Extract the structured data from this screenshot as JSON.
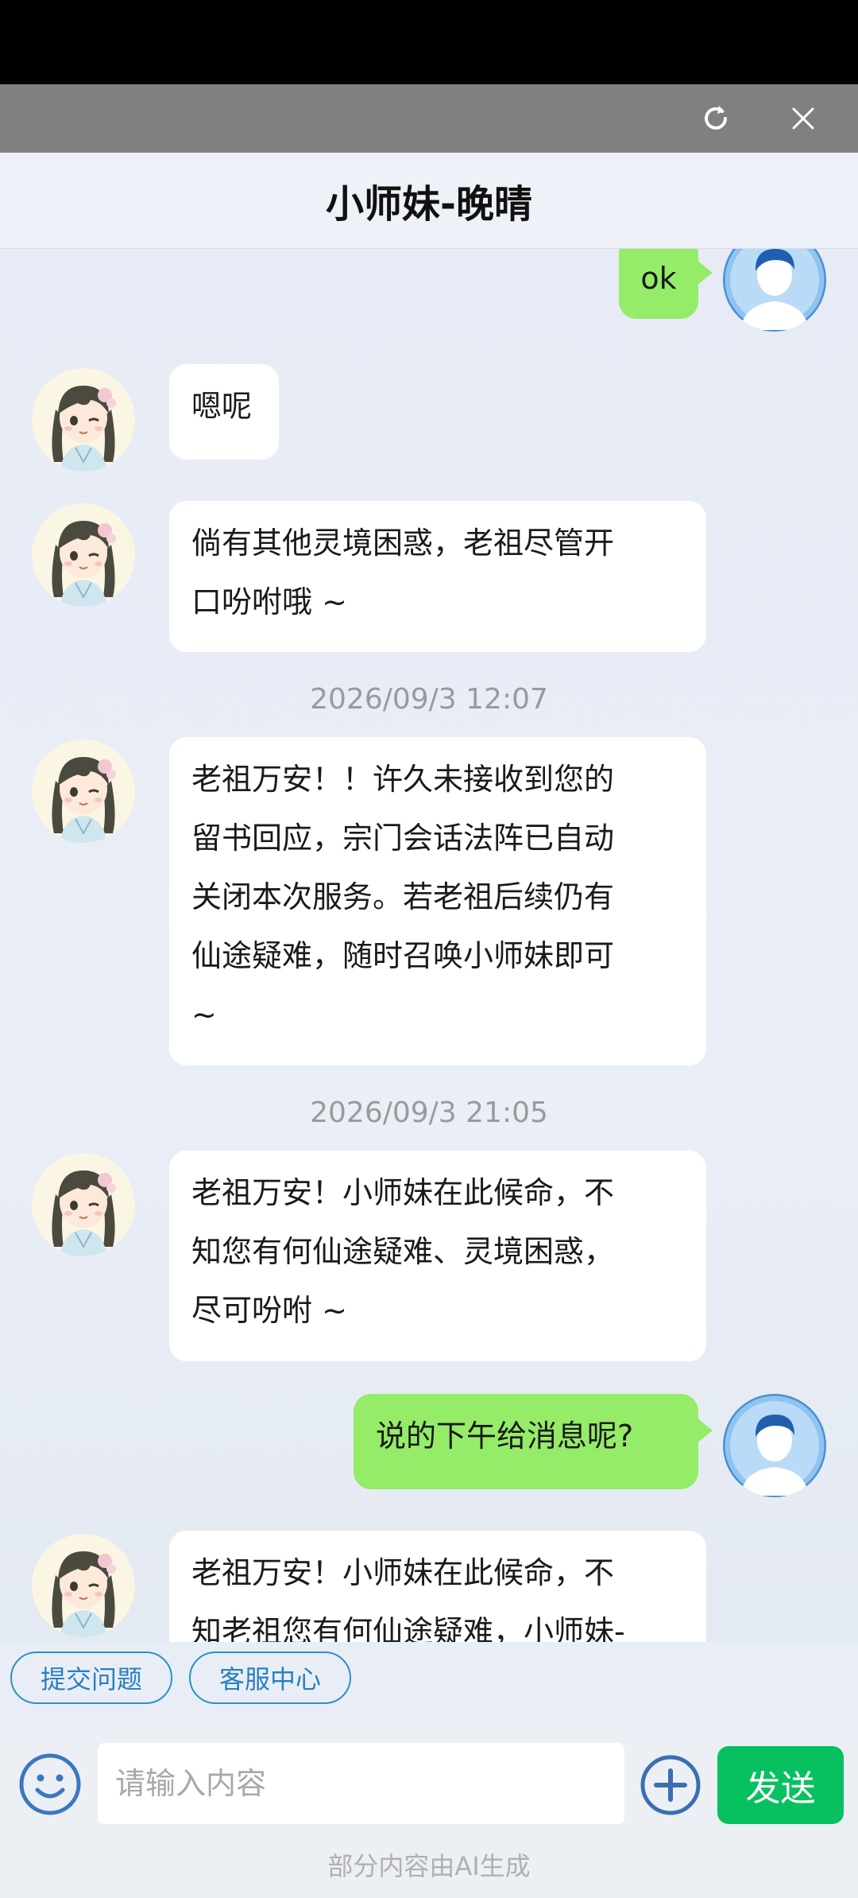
{
  "header": {
    "title": "小师妹-晚晴",
    "refresh_icon": "refresh-icon",
    "close_icon": "close-icon"
  },
  "messages": [
    {
      "sender": "user",
      "text": "ok"
    },
    {
      "sender": "assistant",
      "lines": [
        "嗯呢"
      ]
    },
    {
      "sender": "assistant",
      "lines": [
        "倘有其他灵境困惑，老祖尽管开",
        "口吩咐哦 ~"
      ]
    },
    {
      "timestamp": "2026/09/3 12:07"
    },
    {
      "sender": "assistant",
      "lines": [
        "老祖万安！！许久未接收到您的",
        "留书回应，宗门会话法阵已自动",
        "关闭本次服务。若老祖后续仍有",
        "仙途疑难，随时召唤小师妹即可",
        " ~"
      ]
    },
    {
      "timestamp": "2026/09/3 21:05"
    },
    {
      "sender": "assistant",
      "lines": [
        "老祖万安！小师妹在此候命，不",
        "知您有何仙途疑难、灵境困惑，",
        "尽可吩咐 ~"
      ]
    },
    {
      "sender": "user",
      "text": "说的下午给消息呢?"
    },
    {
      "sender": "assistant",
      "lines": [
        "老祖万安！小师妹在此候命，不",
        "知老祖您有何仙途疑难，小师妹-"
      ]
    }
  ],
  "quick_actions": [
    "提交问题",
    "客服中心"
  ],
  "composer": {
    "placeholder": "请输入内容",
    "send_label": "发送",
    "emoji_icon": "emoji-icon",
    "plus_icon": "plus-circle-icon"
  },
  "footer_note": "部分内容由AI生成",
  "colors": {
    "user_bubble": "#95ec69",
    "send_button": "#07c160",
    "chip_border": "#2a93c2"
  }
}
